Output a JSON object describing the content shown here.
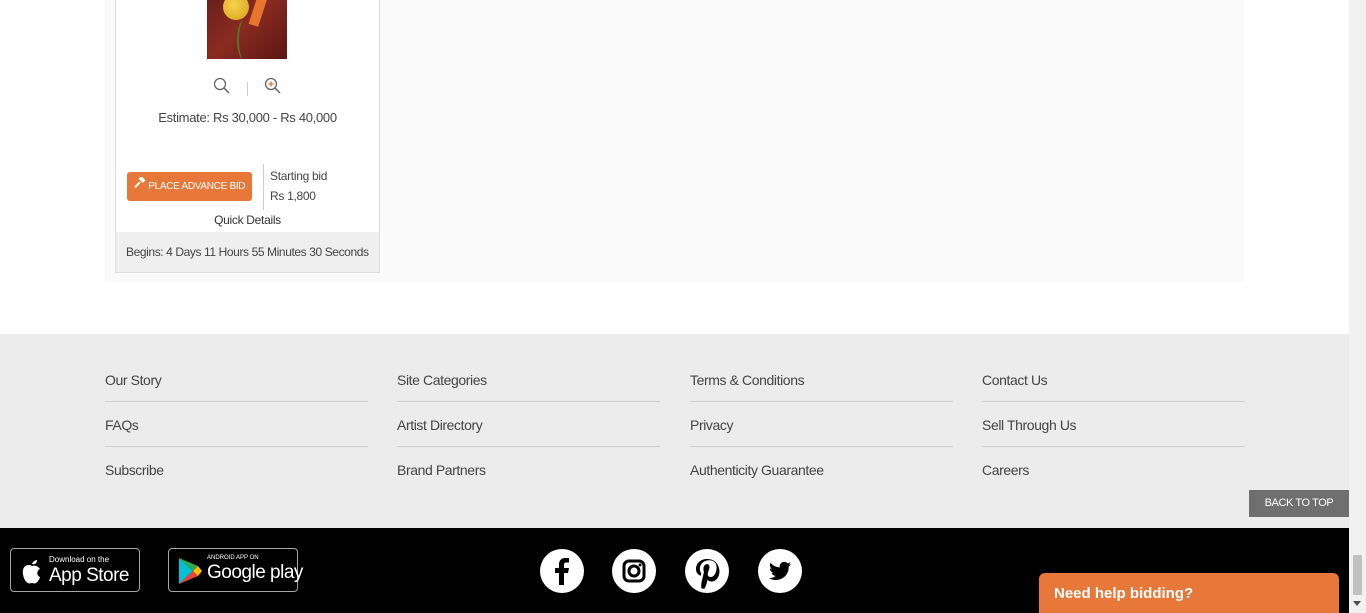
{
  "lot": {
    "estimate": "Estimate: Rs 30,000 - Rs 40,000",
    "bid_button_label": "PLACE ADVANCE BID",
    "starting_bid_label": "Starting bid",
    "starting_bid_value": "Rs 1,800",
    "quick_details": "Quick Details",
    "begins": "Begins: 4 Days 11 Hours 55 Minutes 30 Seconds"
  },
  "footer": {
    "columns": [
      [
        "Our Story",
        "FAQs",
        "Subscribe"
      ],
      [
        "Site Categories",
        "Artist Directory",
        "Brand Partners"
      ],
      [
        "Terms & Conditions",
        "Privacy",
        "Authenticity Guarantee"
      ],
      [
        "Contact Us",
        "Sell Through Us",
        "Careers"
      ]
    ],
    "back_to_top": "BACK TO TOP"
  },
  "apps": {
    "appstore_small": "Download on the",
    "appstore_big": "App Store",
    "play_small": "ANDROID APP ON",
    "play_big": "Google play"
  },
  "social": [
    "facebook-icon",
    "instagram-icon",
    "pinterest-icon",
    "twitter-icon"
  ],
  "help": {
    "label": "Need help bidding?"
  },
  "colors": {
    "accent": "#e8773a",
    "footer_bg": "#ececec",
    "bottom_bar": "#000000"
  }
}
